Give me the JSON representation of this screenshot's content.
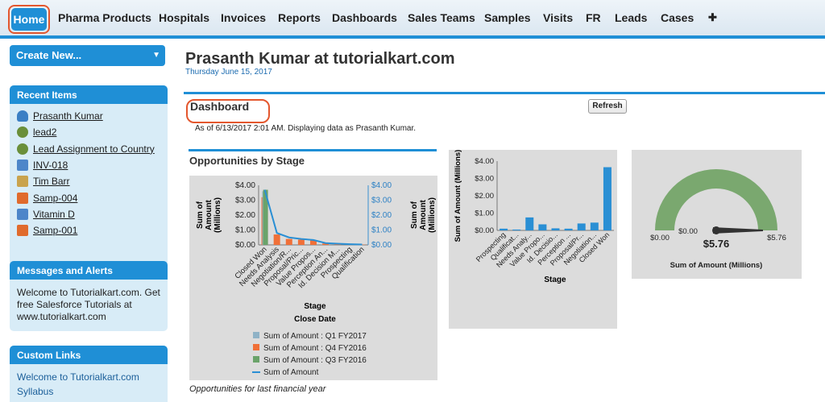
{
  "tabs": [
    {
      "label": "Home",
      "active": true
    },
    {
      "label": "Pharma Products"
    },
    {
      "label": "Hospitals"
    },
    {
      "label": "Invoices"
    },
    {
      "label": "Reports"
    },
    {
      "label": "Dashboards"
    },
    {
      "label": "Sales Teams"
    },
    {
      "label": "Samples"
    },
    {
      "label": "Visits"
    },
    {
      "label": "FR"
    },
    {
      "label": "Leads"
    },
    {
      "label": "Cases"
    },
    {
      "label": "✚"
    }
  ],
  "sidebar": {
    "create_new": "Create New...",
    "recent": {
      "title": "Recent Items",
      "items": [
        {
          "label": "Prasanth Kumar",
          "icon": "person-icon",
          "color": "#3b7fc4"
        },
        {
          "label": "lead2",
          "icon": "lead-icon",
          "color": "#6a8f3a"
        },
        {
          "label": "Lead Assignment to Country",
          "icon": "lead-icon",
          "color": "#6a8f3a"
        },
        {
          "label": "INV-018",
          "icon": "invoice-icon",
          "color": "#4d86c9"
        },
        {
          "label": "Tim Barr",
          "icon": "contact-icon",
          "color": "#c9a34d"
        },
        {
          "label": "Samp-004",
          "icon": "sample-icon",
          "color": "#e06b2d"
        },
        {
          "label": "Vitamin D",
          "icon": "product-icon",
          "color": "#4d86c9"
        },
        {
          "label": "Samp-001",
          "icon": "sample-icon",
          "color": "#e06b2d"
        }
      ]
    },
    "messages": {
      "title": "Messages and Alerts",
      "text": "Welcome to Tutorialkart.com. Get free Salesforce Tutorials at www.tutorialkart.com"
    },
    "custom_links": {
      "title": "Custom Links",
      "links": [
        "Welcome to Tutorialkart.com",
        "Syllabus"
      ]
    }
  },
  "main": {
    "title": "Prasanth Kumar at tutorialkart.com",
    "date": "Thursday June 15, 2017",
    "dashboard_title": "Dashboard",
    "refresh": "Refresh",
    "as_of": "As of 6/13/2017 2:01 AM. Displaying data as Prasanth Kumar.",
    "component_title": "Opportunities by Stage",
    "footer": "Opportunities for last financial year"
  },
  "colors": {
    "accent": "#1f8fd6",
    "highlight": "#e4572e",
    "orange_bar": "#f07038",
    "green": "#6aa36a",
    "steel": "#8fb2c6"
  },
  "chart_data": [
    {
      "type": "bar",
      "ylabel": "Sum of Amount (Millions)",
      "y2label": "Sum of Amount (Millions)",
      "xlabel": "Stage",
      "xlabel2": "Close Date",
      "yticks": [
        "$4.00",
        "$3.00",
        "$2.00",
        "$1.00",
        "$0.00"
      ],
      "ylim": [
        0,
        4
      ],
      "categories": [
        "Closed Won",
        "Needs Analysis",
        "Negotiation/R...",
        "Proposal/Pric...",
        "Value Propos...",
        "Perception An...",
        "Id. Decision M...",
        "Prospecting",
        "Qualification"
      ],
      "series": [
        {
          "name": "Sum of Amount : Q1 FY2017",
          "color": "#8fb2c6",
          "values": [
            3.6,
            0,
            0,
            0,
            0,
            0,
            0,
            0,
            0
          ]
        },
        {
          "name": "Sum of Amount : Q4 FY2016",
          "color": "#f07038",
          "values": [
            3.2,
            0.7,
            0.4,
            0.35,
            0.3,
            0.1,
            0.05,
            0.03,
            0.02
          ]
        },
        {
          "name": "Sum of Amount : Q3 FY2016",
          "color": "#6aa36a",
          "values": [
            3.7,
            0,
            0,
            0,
            0,
            0,
            0,
            0,
            0
          ]
        },
        {
          "name": "Sum of Amount",
          "type": "line",
          "color": "#2a8fd4",
          "values": [
            3.7,
            0.8,
            0.5,
            0.4,
            0.33,
            0.12,
            0.08,
            0.05,
            0.03
          ]
        }
      ]
    },
    {
      "type": "bar",
      "ylabel": "Sum of Amount (Millions)",
      "xlabel": "Stage",
      "yticks": [
        "$4.00",
        "$3.00",
        "$2.00",
        "$1.00",
        "$0.00"
      ],
      "ylim": [
        0,
        4
      ],
      "categories": [
        "Prospecting",
        "Qualificat...",
        "Needs Analy...",
        "Value Propo...",
        "Id. Decisio...",
        "Perception ...",
        "Proposal/Pr...",
        "Negotiation...",
        "Closed Won"
      ],
      "values": [
        0.1,
        0.05,
        0.75,
        0.35,
        0.12,
        0.1,
        0.4,
        0.45,
        3.65
      ]
    },
    {
      "type": "gauge",
      "min_label": "$0.00",
      "max_label": "$5.76",
      "needle_label": "$0.00",
      "value_label": "$5.76",
      "value": 5.76,
      "max": 5.76,
      "caption": "Sum of Amount (Millions)"
    }
  ]
}
